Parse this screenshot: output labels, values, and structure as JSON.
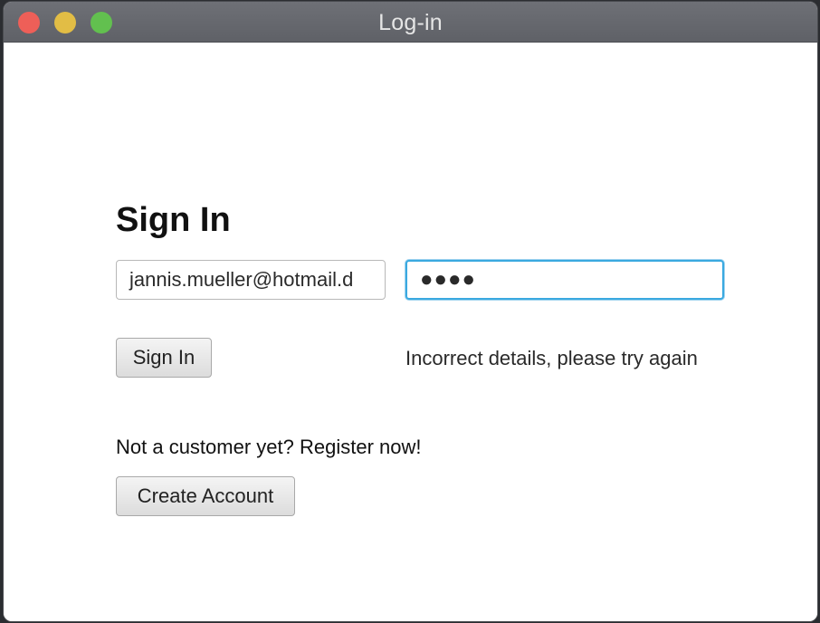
{
  "window": {
    "title": "Log-in"
  },
  "signin": {
    "heading": "Sign In",
    "email_value": "jannis.mueller@hotmail.d",
    "password_masked": "●●●●",
    "button_label": "Sign In",
    "error_message": "Incorrect details, please try again"
  },
  "register": {
    "prompt": "Not a customer yet? Register now!",
    "button_label": "Create Account"
  },
  "colors": {
    "focus_ring": "#3aa9e0",
    "close": "#ee5f58",
    "minimize": "#e2bd45",
    "zoom": "#62c04f"
  }
}
